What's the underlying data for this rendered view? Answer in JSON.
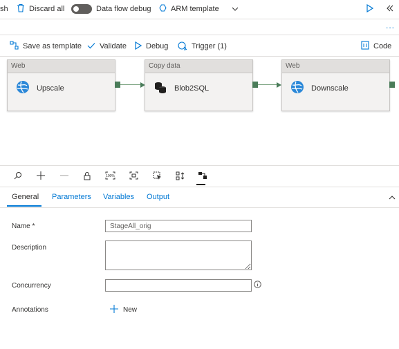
{
  "topbar": {
    "publish_fragment": "sh",
    "discard_all": "Discard all",
    "data_flow_debug": "Data flow debug",
    "arm_template": "ARM template"
  },
  "toolbar": {
    "save_as_template": "Save as template",
    "validate": "Validate",
    "debug": "Debug",
    "trigger": "Trigger (1)",
    "code": "Code",
    "more": "..."
  },
  "pipeline": {
    "activities": [
      {
        "type": "Web",
        "name": "Upscale"
      },
      {
        "type": "Copy data",
        "name": "Blob2SQL"
      },
      {
        "type": "Web",
        "name": "Downscale"
      }
    ]
  },
  "tabs": [
    "General",
    "Parameters",
    "Variables",
    "Output"
  ],
  "form": {
    "name_label": "Name *",
    "name_value": "StageAll_orig",
    "description_label": "Description",
    "description_value": "",
    "concurrency_label": "Concurrency",
    "concurrency_value": "",
    "annotations_label": "Annotations",
    "new_label": "New"
  },
  "icons": [
    "discard-icon",
    "arm-template-icon",
    "chevron-down-icon",
    "play-icon",
    "collapse-icon",
    "save-template-icon",
    "checkmark-icon",
    "debug-play-icon",
    "trigger-icon",
    "code-icon",
    "web-globe-icon",
    "copy-data-icon",
    "search-icon",
    "zoom-in-icon",
    "zoom-out-icon",
    "lock-icon",
    "zoom-100-icon",
    "fit-screen-icon",
    "select-icon",
    "auto-align-icon",
    "layout-icon",
    "info-icon",
    "plus-icon",
    "chevron-up-icon"
  ]
}
